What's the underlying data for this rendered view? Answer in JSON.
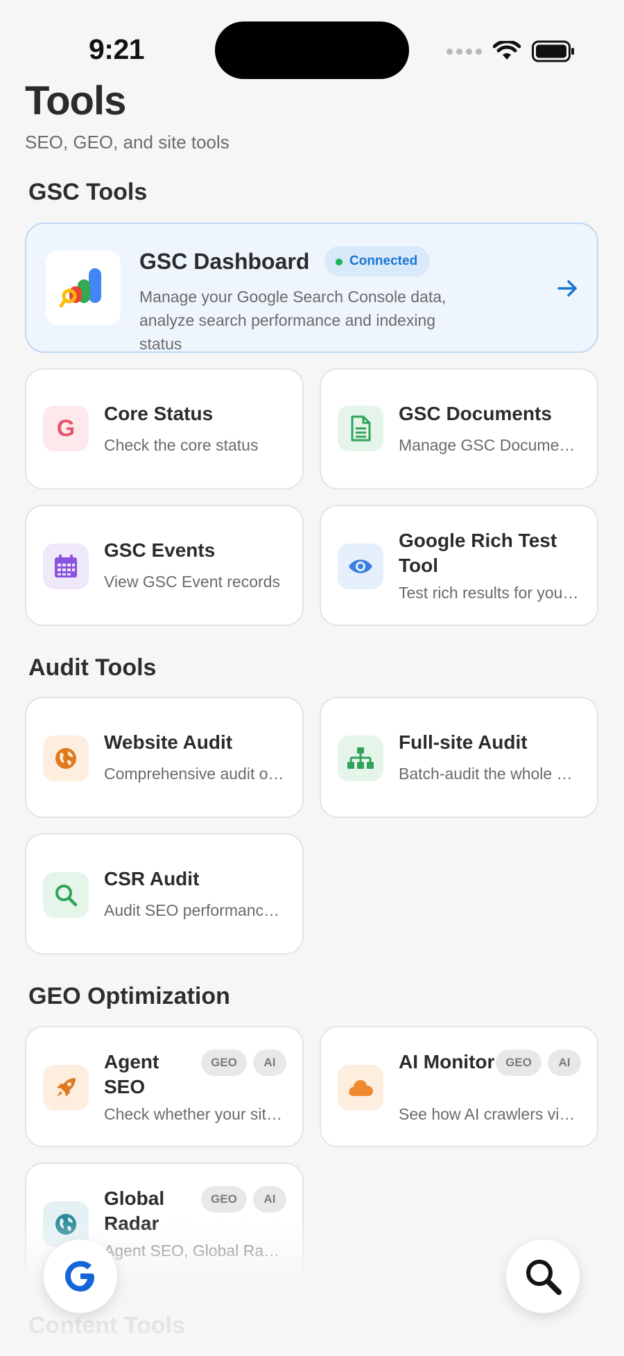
{
  "status_bar": {
    "time": "9:21"
  },
  "header": {
    "title": "Tools",
    "subtitle": "SEO, GEO, and site tools"
  },
  "sections": {
    "gsc": "GSC Tools",
    "audit": "Audit Tools",
    "geo": "GEO Optimization",
    "content": "Content Tools"
  },
  "featured": {
    "title": "GSC Dashboard",
    "badge": "Connected",
    "description": "Manage your Google Search Console data, analyze search performance and indexing status"
  },
  "gsc_cards": [
    {
      "title": "Core Status",
      "desc": "Check the core status",
      "icon": "google-g-icon"
    },
    {
      "title": "GSC Documents",
      "desc": "Manage GSC Documents",
      "icon": "document-icon"
    },
    {
      "title": "GSC Events",
      "desc": "View GSC Event records",
      "icon": "calendar-icon"
    },
    {
      "title": "Google Rich Test Tool",
      "desc": "Test rich results for your pages",
      "icon": "eye-icon"
    }
  ],
  "audit_cards": [
    {
      "title": "Website Audit",
      "desc": "Comprehensive audit of your website",
      "icon": "globe-icon"
    },
    {
      "title": "Full-site Audit",
      "desc": "Batch-audit the whole site",
      "icon": "sitemap-icon"
    },
    {
      "title": "CSR Audit",
      "desc": "Audit SEO performance of CSR pages",
      "icon": "search-icon"
    }
  ],
  "geo_cards": [
    {
      "title": "Agent SEO",
      "desc": "Check whether your site is agent ready",
      "tags": [
        "GEO",
        "AI"
      ],
      "icon": "rocket-icon"
    },
    {
      "title": "AI Monitor",
      "desc": "See how AI crawlers visit your site",
      "tags": [
        "GEO",
        "AI"
      ],
      "icon": "cloud-icon"
    },
    {
      "title": "Global Radar",
      "desc": "Agent SEO, Global Radar",
      "tags": [
        "GEO",
        "AI"
      ],
      "icon": "earth-icon"
    }
  ],
  "colors": {
    "accent": "#1976d2",
    "connected": "#18b55a",
    "card_border": "#e4e4e6",
    "featured_bg": "#eef5fd"
  }
}
